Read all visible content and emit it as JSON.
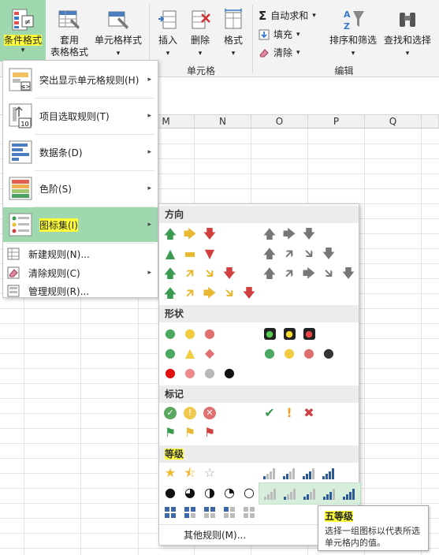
{
  "ribbon": {
    "buttons": [
      {
        "label": "条件格式",
        "name": "conditional-format-button"
      },
      {
        "label": "套用",
        "sub": "表格格式",
        "name": "format-as-table-button"
      },
      {
        "label": "单元格样式",
        "name": "cell-styles-button"
      },
      {
        "label": "插入",
        "name": "insert-button"
      },
      {
        "label": "删除",
        "name": "delete-button"
      },
      {
        "label": "格式",
        "name": "format-button"
      }
    ],
    "small": [
      {
        "label": "自动求和",
        "name": "autosum-button"
      },
      {
        "label": "填充",
        "name": "fill-button"
      },
      {
        "label": "清除",
        "name": "clear-button"
      }
    ],
    "large2": [
      {
        "label": "排序和筛选",
        "name": "sort-filter-button"
      },
      {
        "label": "查找和选择",
        "name": "find-select-button"
      }
    ],
    "groups": {
      "cells": "单元格",
      "editing": "编辑"
    },
    "dropdown_arrow": "▾"
  },
  "columns": [
    "M",
    "N",
    "O",
    "P",
    "Q"
  ],
  "menu": {
    "items": [
      {
        "label": "突出显示单元格规则(H)",
        "icon": "highlight-rules-icon"
      },
      {
        "label": "项目选取规则(T)",
        "icon": "top-bottom-rules-icon"
      },
      {
        "label": "数据条(D)",
        "icon": "data-bars-icon"
      },
      {
        "label": "色阶(S)",
        "icon": "color-scales-icon"
      },
      {
        "label": "图标集(I)",
        "icon": "icon-sets-icon"
      }
    ],
    "small": [
      {
        "label": "新建规则(N)...",
        "icon": "new-rule-icon"
      },
      {
        "label": "清除规则(C)",
        "icon": "clear-rules-icon"
      },
      {
        "label": "管理规则(R)...",
        "icon": "manage-rules-icon"
      }
    ],
    "arrow": "▸"
  },
  "submenu": {
    "sections": [
      "方向",
      "形状",
      "标记",
      "等级"
    ],
    "more": "其他规则(M)..."
  },
  "tooltip": {
    "title": "五等级",
    "desc": "选择一组图标以代表所选单元格内的值。"
  },
  "colors": {
    "highlight": "#9fd8ae",
    "yellow_highlight": "#ffff3a",
    "accent_green": "#217346"
  }
}
